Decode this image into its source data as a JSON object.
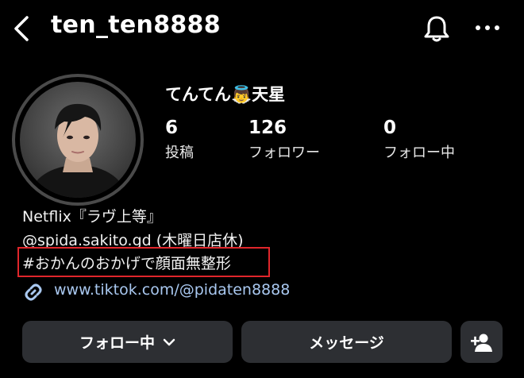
{
  "header": {
    "username": "ten_ten8888"
  },
  "profile": {
    "display_name": "てんてん👼天星",
    "stats": [
      {
        "value": "6",
        "label": "投稿"
      },
      {
        "value": "126",
        "label": "フォロワー"
      },
      {
        "value": "0",
        "label": "フォロー中"
      }
    ]
  },
  "bio": {
    "lines": [
      "Netflix『ラヴ上等』",
      "@spida.sakito.gd (木曜日店休)",
      "#おかんのおかげで顔面無整形"
    ],
    "link": "www.tiktok.com/@pidaten8888"
  },
  "actions": {
    "following_label": "フォロー中",
    "message_label": "メッセージ"
  },
  "colors": {
    "background": "#000000",
    "button": "#2d2f33",
    "link": "#a9c8f0",
    "highlight_box": "#e0262b"
  },
  "icons": [
    "back-arrow-icon",
    "bell-icon",
    "more-icon",
    "link-icon",
    "chevron-down-icon",
    "add-person-icon"
  ]
}
